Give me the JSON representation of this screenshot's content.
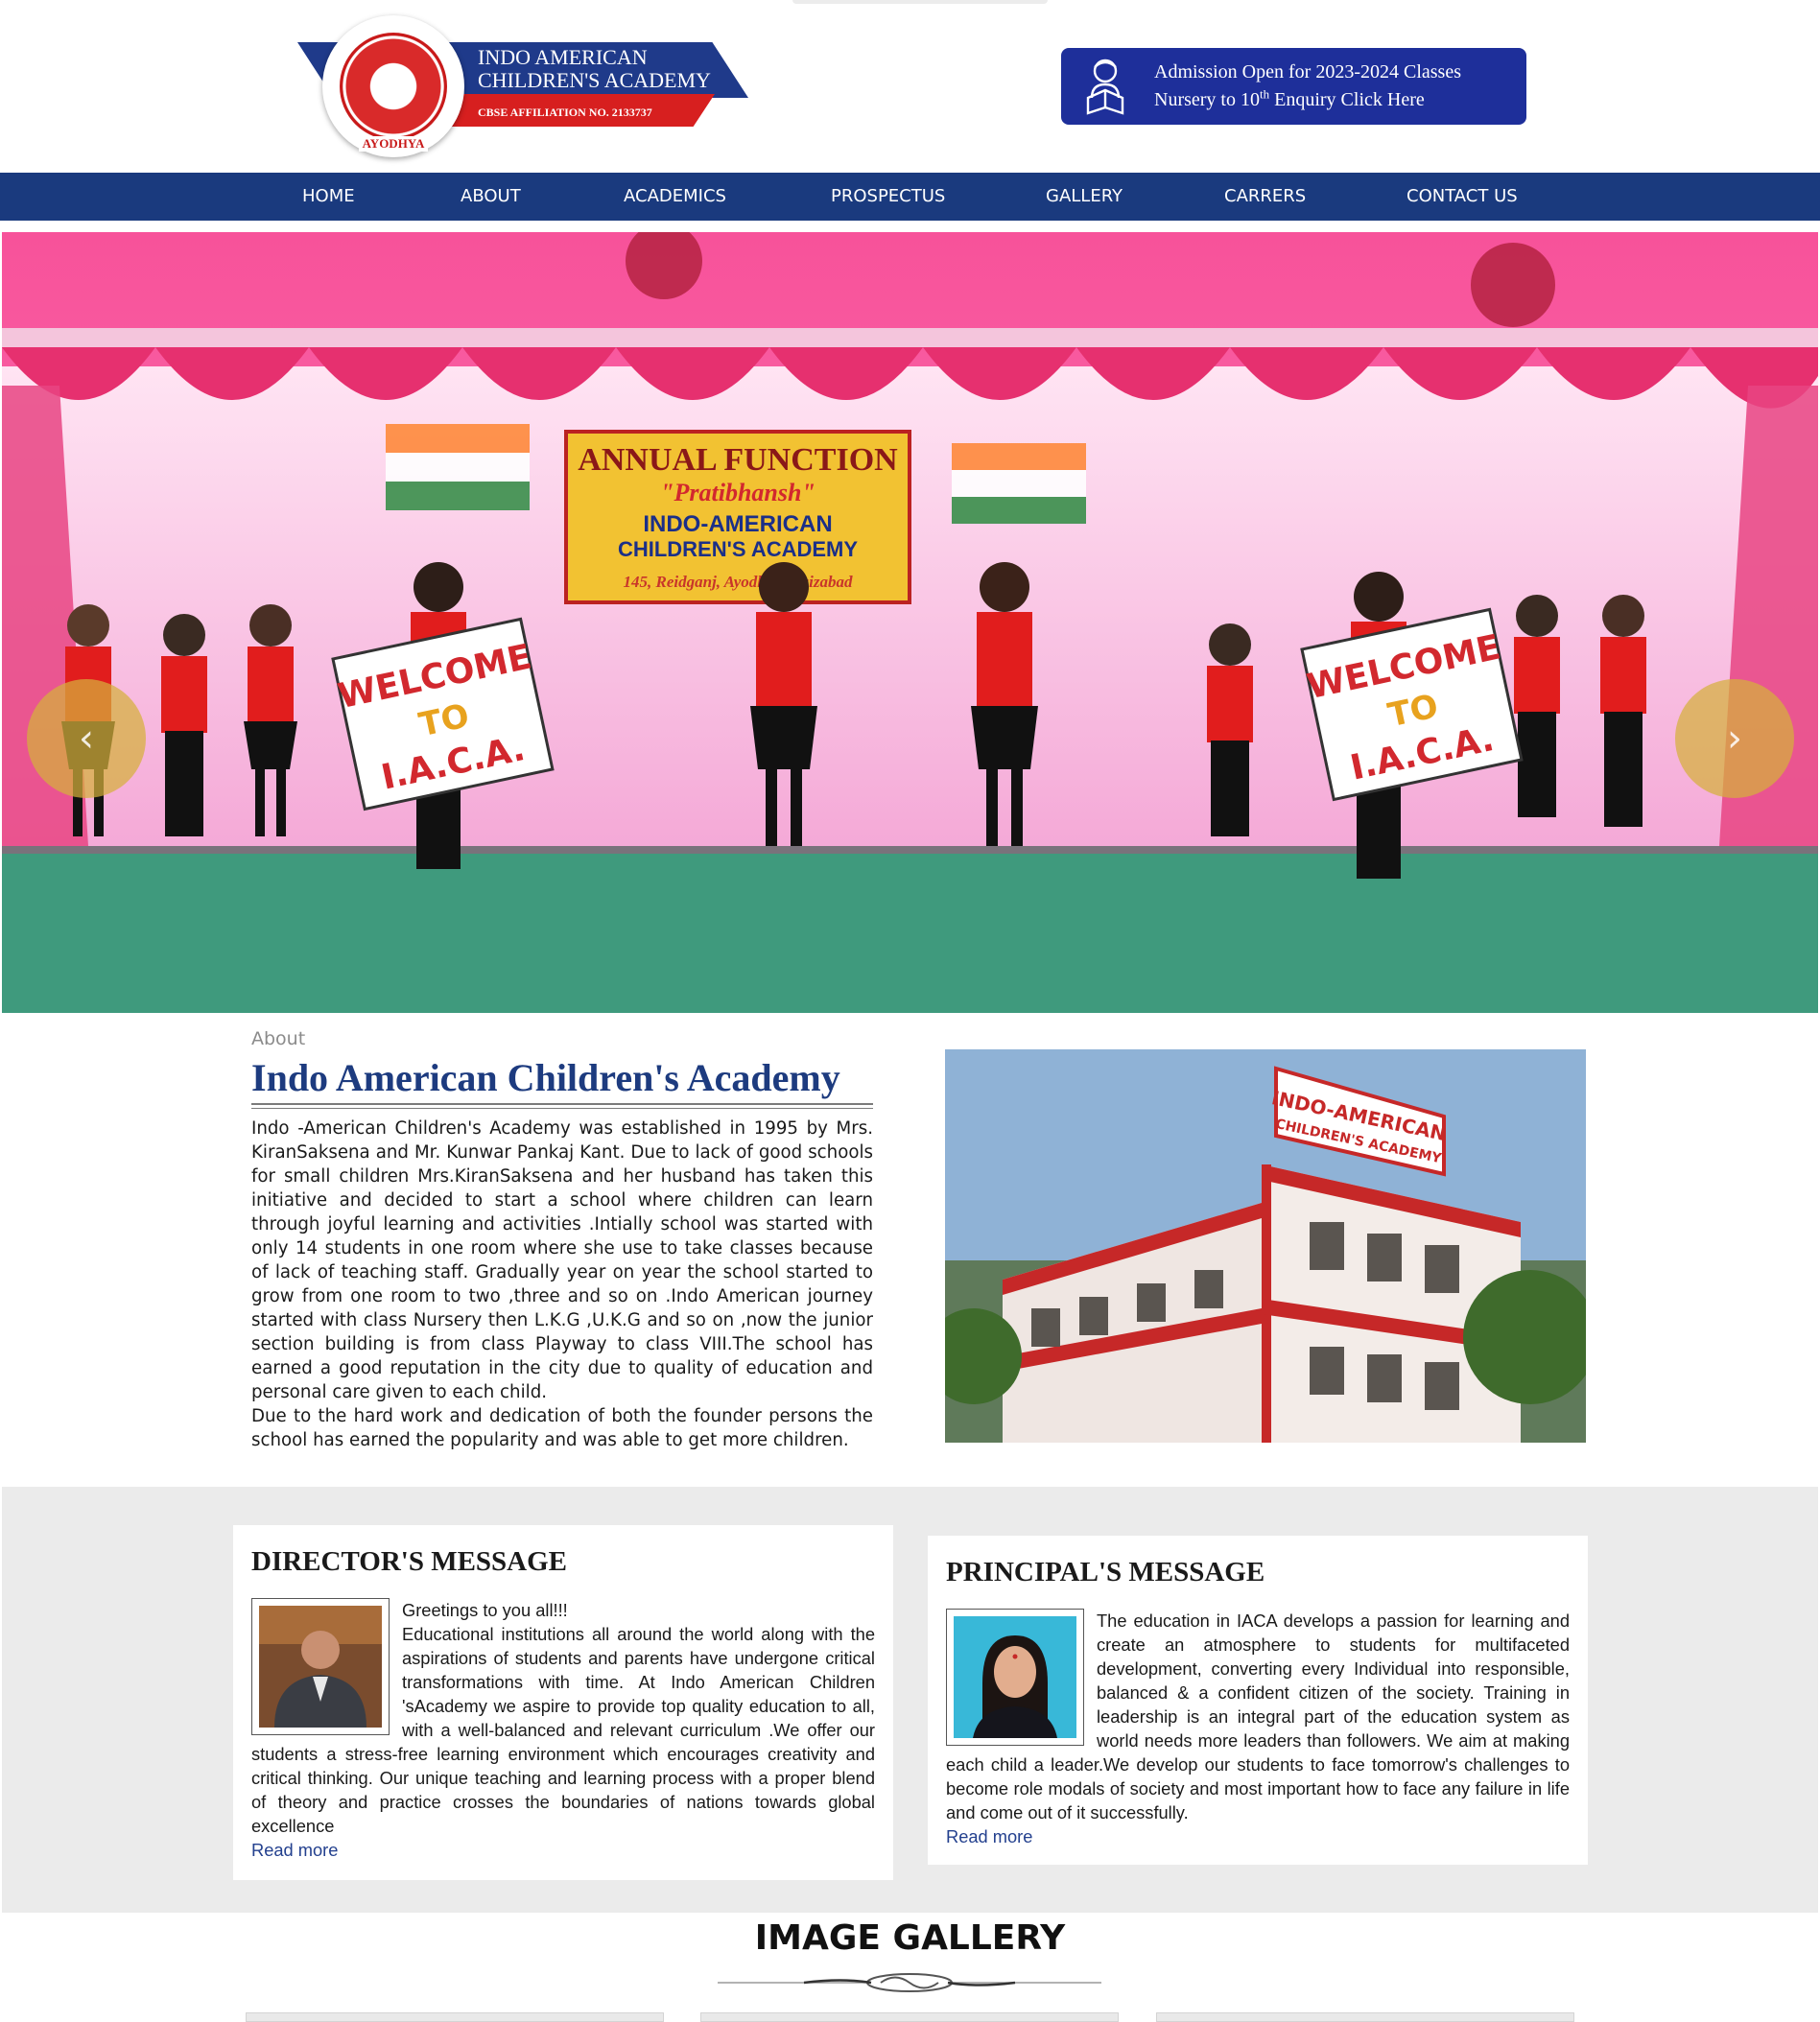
{
  "header": {
    "logo": {
      "name_line1": "INDO AMERICAN",
      "name_line2": "CHILDREN'S ACADEMY",
      "affiliation": "CBSE AFFILIATION NO. 2133737",
      "seal_city": "AYODHYA"
    },
    "admission": {
      "line1": "Admission Open for 2023-2024 Classes",
      "line2_prefix": "Nursery to 10",
      "line2_sup": "th",
      "line2_suffix": " Enquiry Click Here",
      "icon": "student-reading-icon"
    }
  },
  "nav": {
    "items": [
      "HOME",
      "ABOUT",
      "ACADEMICS",
      "PROSPECTUS",
      "GALLERY",
      "CARRERS",
      "CONTACT US"
    ]
  },
  "hero": {
    "prev_icon": "chevron-left-icon",
    "next_icon": "chevron-right-icon",
    "prev_glyph": "‹",
    "next_glyph": "›",
    "banner": {
      "line1": "ANNUAL FUNCTION",
      "line2": "\"Pratibhansh\"",
      "line3": "INDO-AMERICAN",
      "line4": "CHILDREN'S ACADEMY",
      "line5": "145, Reidganj, Ayodhya, Faizabad"
    },
    "signs": {
      "line1": "WELCOME",
      "line2": "TO",
      "line3": "I.A.C.A."
    }
  },
  "about": {
    "eyebrow": "About",
    "title": "Indo American Children's Academy",
    "paragraph1": "Indo -American Children's Academy was established in 1995 by Mrs. KiranSaksena and Mr. Kunwar Pankaj Kant. Due to lack of good schools for small children Mrs.KiranSaksena and her husband has taken this initiative and decided to start a school where children can learn through joyful learning and activities .Intially school was started with only 14 students in one room where she use to take classes because of lack of teaching staff. Gradually year on year the school started to grow from one room to two ,three and so on .Indo American journey started with class Nursery then L.K.G ,U.K.G and so on ,now the junior section building is from class Playway to class VIII.The school has earned a good reputation in the city due to quality of education and personal care given to each child.",
    "paragraph2": "Due to the hard work and dedication of both the founder persons the school has earned the popularity and was able to get more children.",
    "building_sign": "INDO-AMERICAN",
    "building_sign2": "CHILDREN'S ACADEMY"
  },
  "director": {
    "title": "DIRECTOR'S MESSAGE",
    "greeting": "Greetings to you all!!!",
    "body": "Educational institutions all around the world along with the aspirations of students and parents have undergone critical transformations with time. At Indo American Children 'sAcademy we aspire to provide top quality education to all, with a well-balanced and relevant curriculum .We offer our students a stress-free learning environment which encourages creativity and critical thinking. Our unique teaching and learning process with a proper blend of theory and practice crosses the boundaries of nations towards global excellence",
    "read_more": "Read more"
  },
  "principal": {
    "title": "PRINCIPAL'S MESSAGE",
    "body": "The education in IACA develops a passion for learning and create an atmosphere to students for multifaceted development, converting every Individual into responsible, balanced & a confident citizen of the society. Training in leadership is an integral part of the education system as world needs more leaders than followers. We aim at making each child a leader.We develop our students to face tomorrow's challenges to become role modals of society and most important how to face any failure in life and come out of it successfully.",
    "read_more": "Read more"
  },
  "gallery": {
    "title": "IMAGE GALLERY"
  },
  "colors": {
    "nav_bg": "#1a3a7e",
    "admission_bg": "#1e2f9a",
    "title_blue": "#1d3b7f",
    "brand_red": "#d71f1f",
    "section_grey": "#ebebeb"
  }
}
